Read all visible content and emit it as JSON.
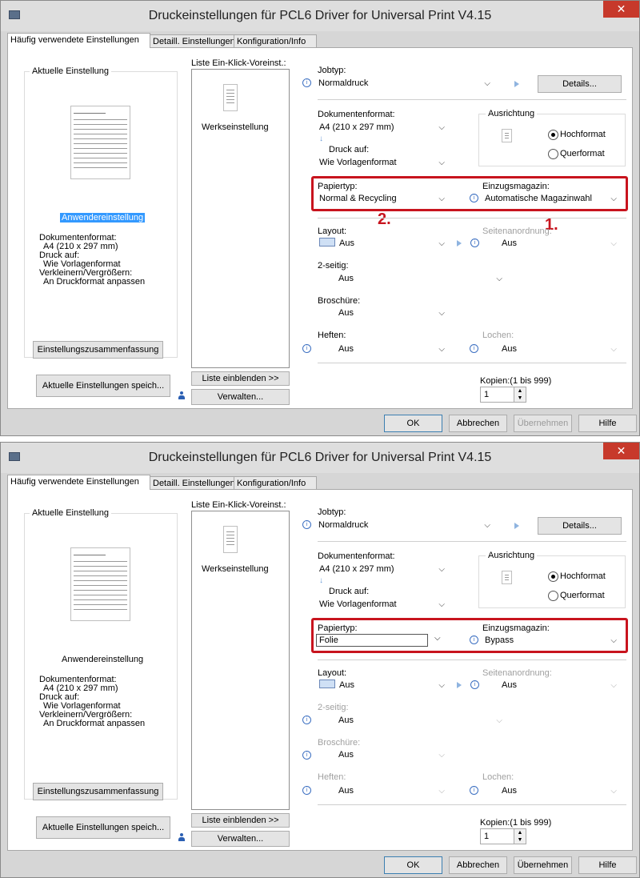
{
  "window_title": "Druckeinstellungen für PCL6 Driver for Universal Print V4.15",
  "tabs": [
    "Häufig verwendete Einstellungen",
    "Detaill. Einstellungen",
    "Konfiguration/Info"
  ],
  "left": {
    "current_setting_label": "Aktuelle Einstellung",
    "user_setting": "Anwendereinstellung",
    "summary_lines": [
      "Dokumentenformat:",
      "A4 (210 x 297 mm)",
      "Druck auf:",
      "Wie Vorlagenformat",
      "Verkleinern/Vergrößern:",
      "An Druckformat anpassen"
    ],
    "summary_button": "Einstellungszusammenfassung",
    "save_button": "Aktuelle Einstellungen speich..."
  },
  "oneclick": {
    "label": "Liste Ein-Klick-Voreinst.:",
    "item": "Werkseinstellung",
    "show_list_button": "Liste einblenden >>",
    "manage_button": "Verwalten..."
  },
  "labels": {
    "jobtype": "Jobtyp:",
    "details": "Details...",
    "docformat": "Dokumentenformat:",
    "orientation": "Ausrichtung",
    "portrait": "Hochformat",
    "landscape": "Querformat",
    "print_on": "Druck auf:",
    "papertype": "Papiertyp:",
    "tray": "Einzugsmagazin:",
    "layout": "Layout:",
    "page_order": "Seitenanordnung:",
    "duplex": "2-seitig:",
    "booklet": "Broschüre:",
    "staple": "Heften:",
    "punch": "Lochen:",
    "copies": "Kopien:(1 bis 999)"
  },
  "values": {
    "jobtype": "Normaldruck",
    "docformat": "A4 (210 x 297 mm)",
    "print_on": "Wie Vorlagenformat",
    "layout": "Aus",
    "page_order": "Aus",
    "duplex": "Aus",
    "booklet": "Aus",
    "staple": "Aus",
    "punch": "Aus",
    "copies": "1"
  },
  "screen1": {
    "papertype": "Normal & Recycling",
    "tray": "Automatische Magazinwahl"
  },
  "screen2": {
    "papertype": "Folie",
    "tray": "Bypass"
  },
  "markers": {
    "one": "1.",
    "two": "2."
  },
  "buttons": {
    "ok": "OK",
    "cancel": "Abbrechen",
    "apply": "Übernehmen",
    "help": "Hilfe"
  },
  "icons": {
    "close": "close-icon",
    "info": "info-icon",
    "arrow": "arrow-right-icon",
    "user": "user-icon"
  }
}
